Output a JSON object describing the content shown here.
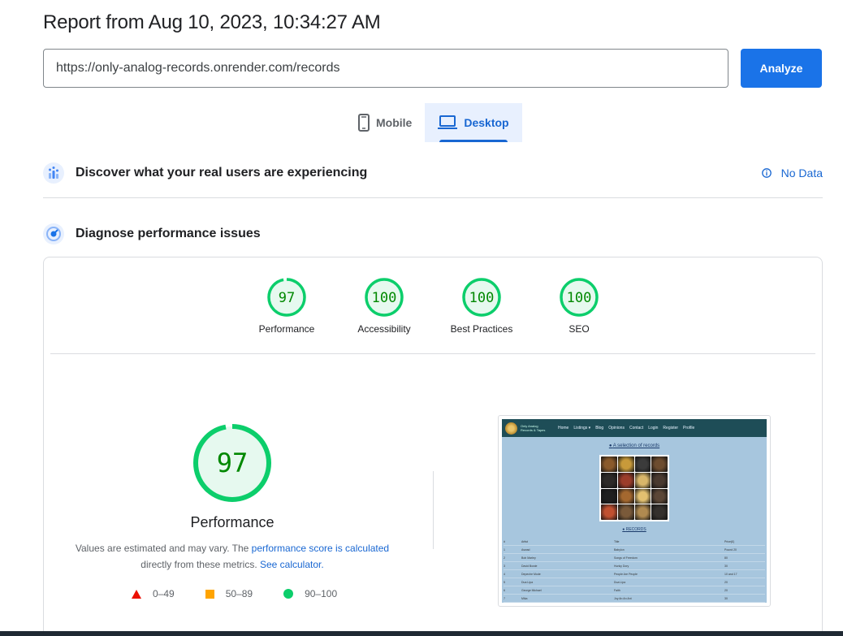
{
  "header": {
    "report_title": "Report from Aug 10, 2023, 10:34:27 AM"
  },
  "url_input": {
    "value": "https://only-analog-records.onrender.com/records"
  },
  "analyze_button": {
    "label": "Analyze"
  },
  "tabs": [
    {
      "label": "Mobile",
      "icon": "smartphone-icon",
      "selected": false
    },
    {
      "label": "Desktop",
      "icon": "laptop-icon",
      "selected": true
    }
  ],
  "field_data": {
    "title": "Discover what your real users are experiencing",
    "status": "No Data",
    "icon": "crux-users-icon"
  },
  "lab_data": {
    "title": "Diagnose performance issues",
    "icon": "lighthouse-icon"
  },
  "categories": [
    {
      "label": "Performance",
      "score": "97",
      "fraction": 0.97
    },
    {
      "label": "Accessibility",
      "score": "100",
      "fraction": 1.0
    },
    {
      "label": "Best Practices",
      "score": "100",
      "fraction": 1.0
    },
    {
      "label": "SEO",
      "score": "100",
      "fraction": 1.0
    }
  ],
  "performance": {
    "score": "97",
    "fraction": 0.97,
    "title": "Performance",
    "note_prefix": "Values are estimated and may vary. The ",
    "note_link1": "performance score is calculated",
    "note_mid": " directly from these metrics. ",
    "note_link2": "See calculator."
  },
  "legend": [
    {
      "range": "0–49",
      "shape": "triangle",
      "color": "#eb0f00"
    },
    {
      "range": "50–89",
      "shape": "square",
      "color": "#ffa400"
    },
    {
      "range": "90–100",
      "shape": "circle",
      "color": "#0cce6b"
    }
  ],
  "colors": {
    "accent": "#1a73e8",
    "pass": "#0cce6b",
    "pass_text": "#008800",
    "pass_bg": "#e6f9ef"
  },
  "screenshot": {
    "nav_brand": "Only Analog Records & Tapes",
    "nav_links": [
      "Home",
      "Listings ▾",
      "Blog",
      "Opinions",
      "Contact",
      "Login",
      "Register",
      "Profile"
    ],
    "heading": "A selection of records",
    "records_label": "RECORDS",
    "table_header": [
      "#",
      "Artist",
      "Title",
      "Price(£)"
    ],
    "rows": [
      [
        "1",
        "Aswad",
        "Babylon",
        "Pound 20"
      ],
      [
        "2",
        "Bob Marley",
        "Songs of Freedom",
        "80"
      ],
      [
        "3",
        "David Bowie",
        "Hunky Dory",
        "30"
      ],
      [
        "4",
        "Depeche Mode",
        "People Are People",
        "10 and 17"
      ],
      [
        "5",
        "Dua Lipa",
        "Dua Lipa",
        "20"
      ],
      [
        "6",
        "George Michael",
        "Faith",
        "20"
      ],
      [
        "7",
        "Mika",
        "Joy An An Ant",
        "30"
      ]
    ]
  }
}
